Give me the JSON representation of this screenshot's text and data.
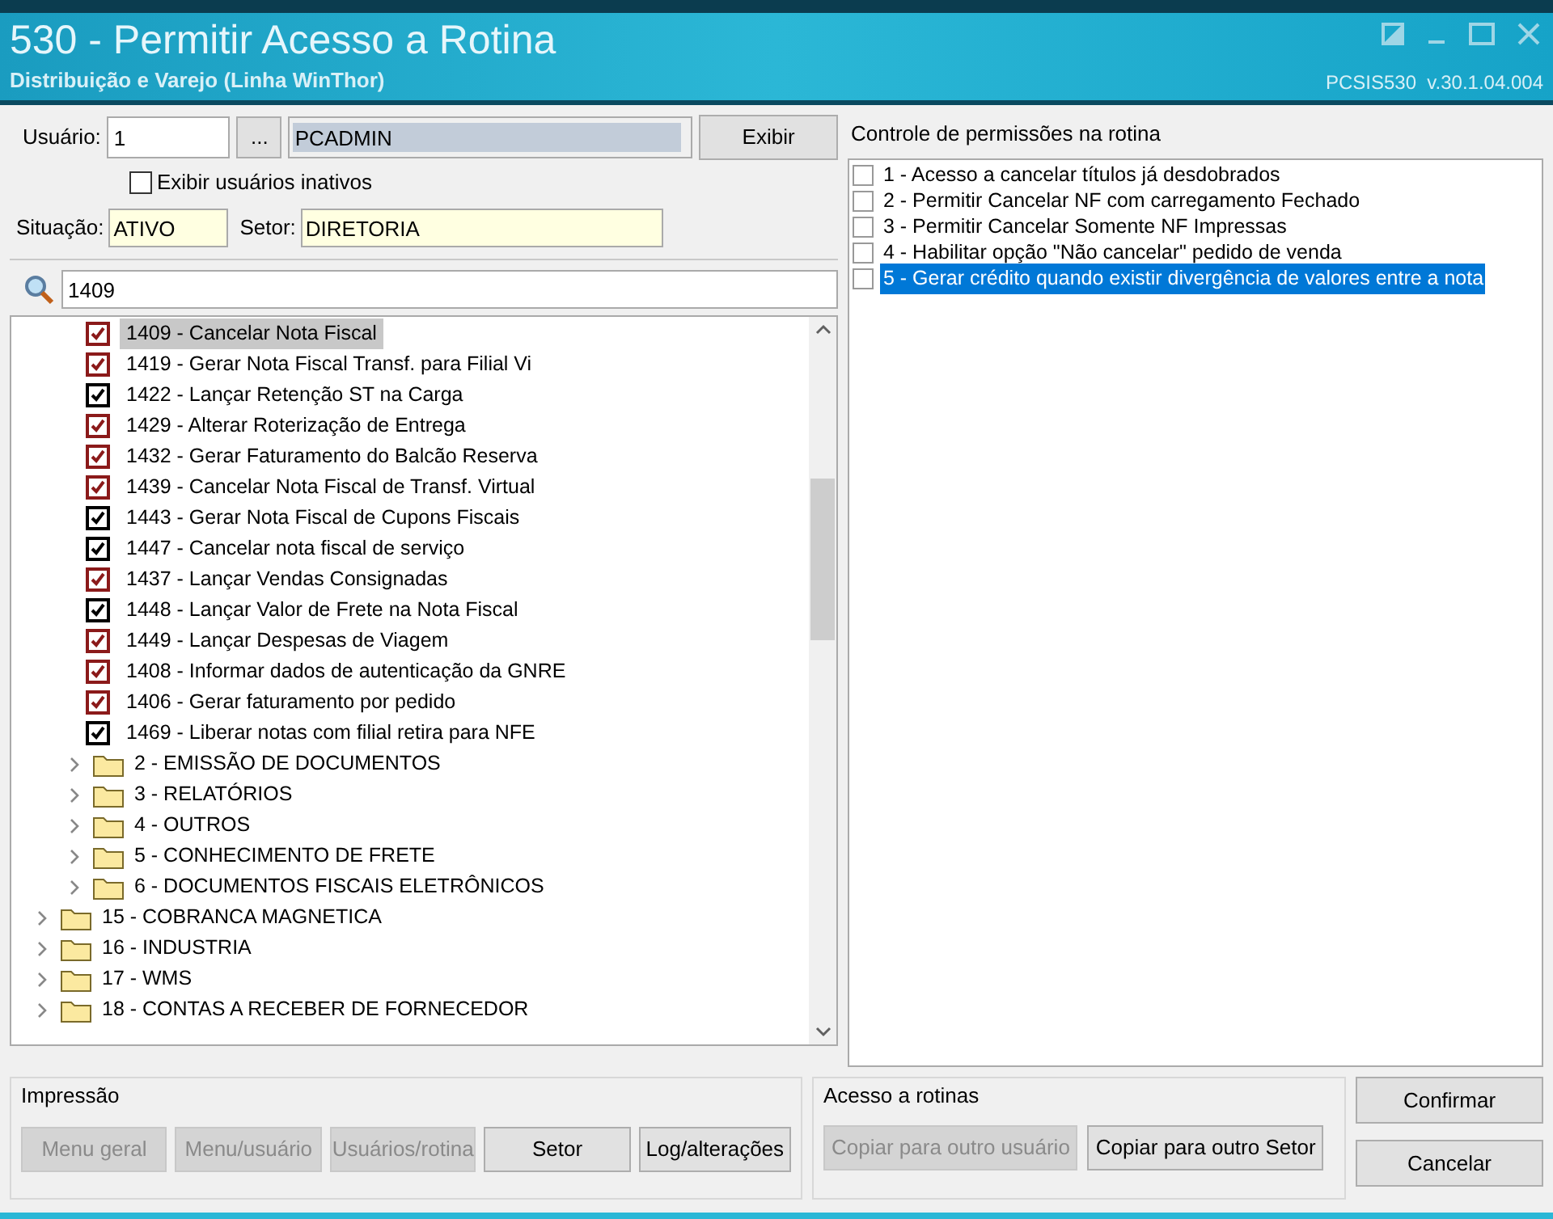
{
  "window": {
    "title": "530 - Permitir Acesso a Rotina",
    "subtitle": "Distribuição e Varejo (Linha WinThor)",
    "version": "PCSIS530  v.30.1.04.004"
  },
  "user": {
    "label": "Usuário:",
    "code": "1",
    "lookup": "...",
    "name": "PCADMIN",
    "show_button": "Exibir"
  },
  "show_inactive": {
    "label": "Exibir usuários inativos",
    "checked": false
  },
  "status": {
    "label": "Situação:",
    "value": "ATIVO"
  },
  "sector": {
    "label": "Setor:",
    "value": "DIRETORIA"
  },
  "search": {
    "value": "1409"
  },
  "tree": [
    {
      "children": [
        {
          "children": [
            {
              "label": "1409 - Cancelar Nota Fiscal",
              "checked": true,
              "color": "#8b1a1a",
              "selected": true
            },
            {
              "label": "1419 - Gerar Nota Fiscal Transf. para Filial Vi",
              "checked": true,
              "color": "#8b1a1a",
              "selected": false
            },
            {
              "label": "1422 - Lançar Retenção ST na Carga",
              "checked": true,
              "color": "#000000",
              "selected": false
            },
            {
              "label": "1429 - Alterar Roterização de Entrega",
              "checked": true,
              "color": "#8b1a1a",
              "selected": false
            },
            {
              "label": "1432 - Gerar Faturamento do Balcão Reserva",
              "checked": true,
              "color": "#8b1a1a",
              "selected": false
            },
            {
              "label": "1439 - Cancelar Nota Fiscal de Transf. Virtual",
              "checked": true,
              "color": "#8b1a1a",
              "selected": false
            },
            {
              "label": "1443 - Gerar Nota Fiscal de Cupons Fiscais",
              "checked": true,
              "color": "#000000",
              "selected": false
            },
            {
              "label": "1447 - Cancelar nota fiscal de serviço",
              "checked": true,
              "color": "#000000",
              "selected": false
            },
            {
              "label": "1437 - Lançar Vendas Consignadas",
              "checked": true,
              "color": "#8b1a1a",
              "selected": false
            },
            {
              "label": "1448 - Lançar Valor de Frete na Nota Fiscal",
              "checked": true,
              "color": "#000000",
              "selected": false
            },
            {
              "label": "1449 - Lançar Despesas de Viagem",
              "checked": true,
              "color": "#8b1a1a",
              "selected": false
            },
            {
              "label": "1408 - Informar dados de autenticação da GNRE",
              "checked": true,
              "color": "#8b1a1a",
              "selected": false
            },
            {
              "label": "1406 - Gerar faturamento por pedido",
              "checked": true,
              "color": "#8b1a1a",
              "selected": false
            },
            {
              "label": "1469 - Liberar notas com filial retira para NFE",
              "checked": true,
              "color": "#000000",
              "selected": false
            }
          ]
        },
        {
          "label": "2 - EMISSÃO DE DOCUMENTOS",
          "kind": "folder",
          "expanded": false
        },
        {
          "label": "3 - RELATÓRIOS",
          "kind": "folder",
          "expanded": false
        },
        {
          "label": "4 - OUTROS",
          "kind": "folder",
          "expanded": false
        },
        {
          "label": "5 - CONHECIMENTO DE FRETE",
          "kind": "folder",
          "expanded": false
        },
        {
          "label": "6 - DOCUMENTOS FISCAIS ELETRÔNICOS",
          "kind": "folder",
          "expanded": false
        }
      ]
    },
    {
      "label": "15 - COBRANCA MAGNETICA",
      "kind": "folder",
      "expanded": false
    },
    {
      "label": "16 - INDUSTRIA",
      "kind": "folder",
      "expanded": false
    },
    {
      "label": "17 - WMS",
      "kind": "folder",
      "expanded": false
    },
    {
      "label": "18 - CONTAS A RECEBER DE FORNECEDOR",
      "kind": "folder",
      "expanded": false
    }
  ],
  "permissions": {
    "title": "Controle de permissões na rotina",
    "items": [
      {
        "label": "1 - Acesso a cancelar títulos já desdobrados",
        "checked": false,
        "selected": false
      },
      {
        "label": "2 - Permitir Cancelar NF com carregamento Fechado",
        "checked": false,
        "selected": false
      },
      {
        "label": "3 - Permitir Cancelar Somente NF Impressas",
        "checked": false,
        "selected": false
      },
      {
        "label": "4 - Habilitar opção \"Não cancelar\" pedido de venda",
        "checked": false,
        "selected": false
      },
      {
        "label": "5 - Gerar crédito quando existir divergência de valores entre a nota",
        "checked": false,
        "selected": true
      }
    ]
  },
  "printing": {
    "title": "Impressão",
    "buttons": [
      {
        "label": "Menu geral",
        "disabled": true
      },
      {
        "label": "Menu/usuário",
        "disabled": true
      },
      {
        "label": "Usuários/rotina",
        "disabled": true
      },
      {
        "label": "Setor",
        "disabled": false
      },
      {
        "label": "Log/alterações",
        "disabled": false
      }
    ]
  },
  "access": {
    "title": "Acesso a rotinas",
    "buttons": [
      {
        "label": "Copiar para outro usuário",
        "disabled": true
      },
      {
        "label": "Copiar para outro Setor",
        "disabled": false
      }
    ]
  },
  "actions": [
    "Confirmar",
    "Cancelar"
  ]
}
